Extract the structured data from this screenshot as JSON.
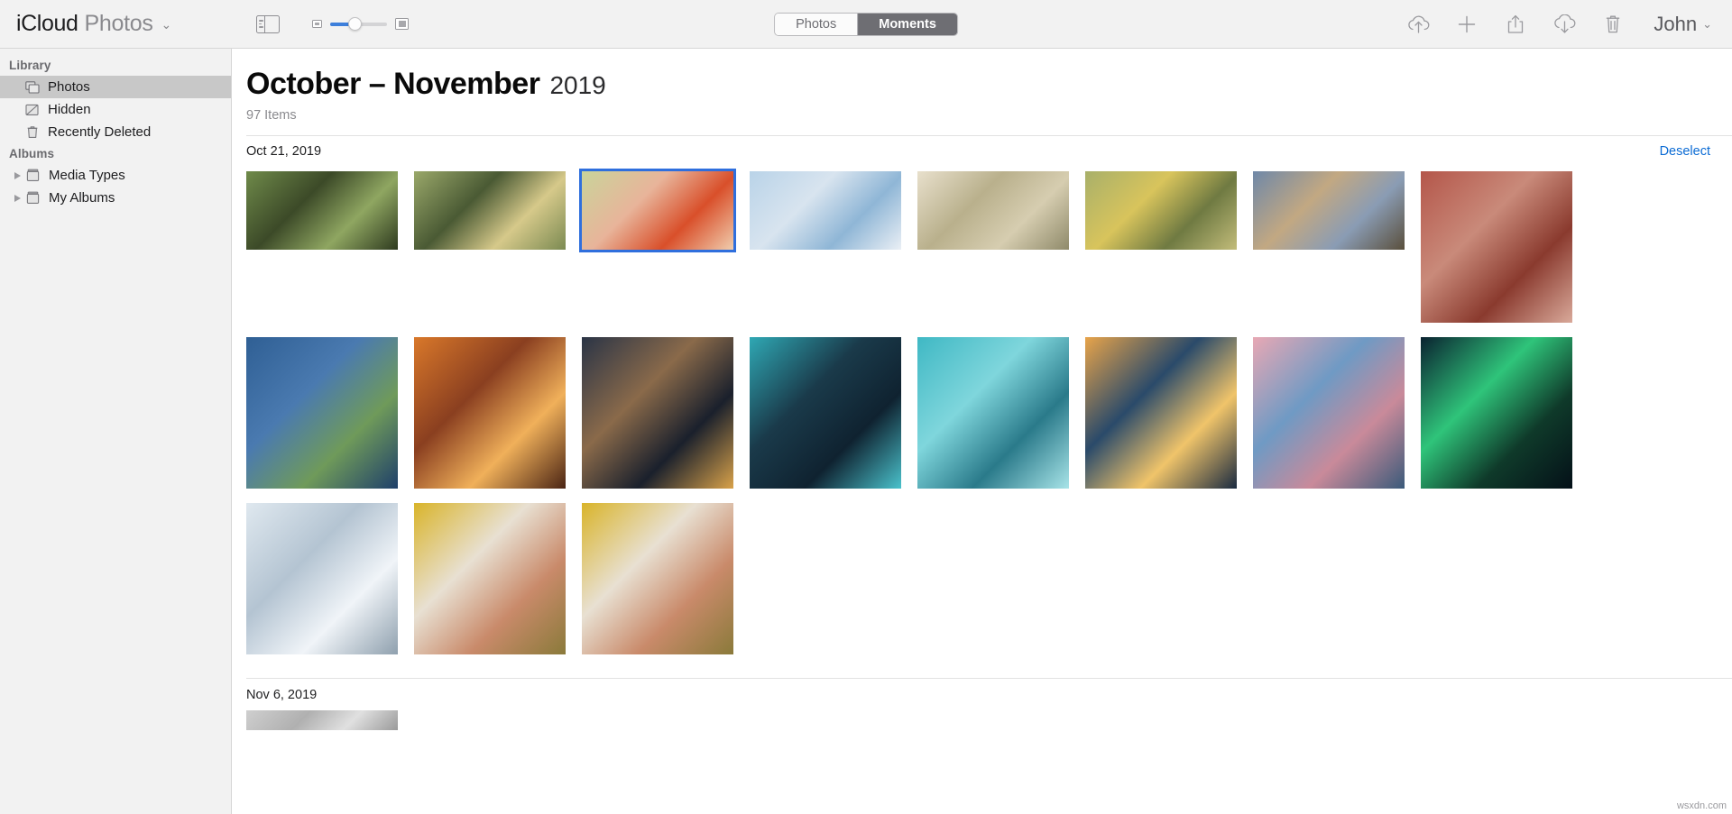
{
  "toolbar": {
    "brand_primary": "iCloud",
    "brand_secondary": "Photos",
    "brand_caret": "⌄",
    "sidebar_toggle_icon": "sidebar-toggle-icon",
    "zoom_small_icon": "small-thumbnail-icon",
    "zoom_large_icon": "large-thumbnail-icon",
    "zoom_value_percent": 38,
    "segments": [
      {
        "label": "Photos",
        "active": false
      },
      {
        "label": "Moments",
        "active": true
      }
    ],
    "actions": [
      {
        "name": "upload-icon",
        "title": "Upload"
      },
      {
        "name": "plus-icon",
        "title": "Add"
      },
      {
        "name": "share-icon",
        "title": "Share"
      },
      {
        "name": "download-icon",
        "title": "Download"
      },
      {
        "name": "trash-icon",
        "title": "Delete"
      }
    ],
    "account_name": "John",
    "account_caret": "⌄"
  },
  "sidebar": {
    "sections": [
      {
        "title": "Library",
        "items": [
          {
            "label": "Photos",
            "icon": "photos-stack-icon",
            "selected": true,
            "expandable": false
          },
          {
            "label": "Hidden",
            "icon": "hidden-icon",
            "selected": false,
            "expandable": false
          },
          {
            "label": "Recently Deleted",
            "icon": "trash-icon",
            "selected": false,
            "expandable": false
          }
        ]
      },
      {
        "title": "Albums",
        "items": [
          {
            "label": "Media Types",
            "icon": "album-folder-icon",
            "selected": false,
            "expandable": true
          },
          {
            "label": "My Albums",
            "icon": "album-folder-icon",
            "selected": false,
            "expandable": true
          }
        ]
      }
    ]
  },
  "main": {
    "title_range": "October – November",
    "title_year": "2019",
    "item_count": "97 Items",
    "groups": [
      {
        "date": "Oct 21, 2019",
        "action_label": "Deselect",
        "photos": [
          {
            "name": "photo-birdhouse-autumn",
            "selected": false,
            "tall": false,
            "colors": [
              "#6f8a4a",
              "#3c4a28",
              "#8fa661",
              "#2e3a1f"
            ]
          },
          {
            "name": "photo-tree-blossom",
            "selected": false,
            "tall": false,
            "colors": [
              "#9aa86a",
              "#4a5a34",
              "#d6c98a",
              "#7b8a52"
            ]
          },
          {
            "name": "photo-red-leaf-hand",
            "selected": true,
            "tall": false,
            "colors": [
              "#c9d49a",
              "#e8b49a",
              "#d94f2a",
              "#f0cdae"
            ]
          },
          {
            "name": "photo-sky-pastel",
            "selected": false,
            "tall": false,
            "colors": [
              "#b9d3e8",
              "#d8e4ef",
              "#8fb6d6",
              "#eaeff5"
            ]
          },
          {
            "name": "photo-white-rose",
            "selected": false,
            "tall": false,
            "colors": [
              "#e8e0cc",
              "#b9b08c",
              "#d6cdb0",
              "#8f8a6a"
            ]
          },
          {
            "name": "photo-yellow-rose",
            "selected": false,
            "tall": false,
            "colors": [
              "#a8b06a",
              "#d8c45c",
              "#6f7a42",
              "#c2bc7a"
            ]
          },
          {
            "name": "photo-desert-road",
            "selected": false,
            "tall": false,
            "colors": [
              "#6f88a8",
              "#c2a882",
              "#8a9cb4",
              "#5a4f3c"
            ]
          },
          {
            "name": "photo-pink-blossom-wall",
            "selected": false,
            "tall": true,
            "colors": [
              "#b4564a",
              "#c98a7a",
              "#8a3a2e",
              "#d9a99a"
            ]
          },
          {
            "name": "photo-tiny-planet-castle",
            "selected": false,
            "tall": true,
            "colors": [
              "#2f5f94",
              "#4a7ab0",
              "#6f9a5a",
              "#1e3f6a"
            ]
          },
          {
            "name": "photo-sunset-street",
            "selected": false,
            "tall": true,
            "colors": [
              "#d9782a",
              "#8a3f20",
              "#f0b05a",
              "#4a2414"
            ]
          },
          {
            "name": "photo-night-city-street",
            "selected": false,
            "tall": true,
            "colors": [
              "#2a3446",
              "#8a6a4a",
              "#1a202c",
              "#d9a24a"
            ]
          },
          {
            "name": "photo-city-skyline-dusk",
            "selected": false,
            "tall": true,
            "colors": [
              "#2fa8b4",
              "#1a3a4a",
              "#0f2230",
              "#4ac2cc"
            ]
          },
          {
            "name": "photo-heart-island",
            "selected": false,
            "tall": true,
            "colors": [
              "#3fb8c4",
              "#7fd6dc",
              "#2a7a8a",
              "#a8e4e8"
            ]
          },
          {
            "name": "photo-eiffel-tower-sunset",
            "selected": false,
            "tall": true,
            "colors": [
              "#e8a44a",
              "#2a4a6a",
              "#f0c46a",
              "#1a2a40"
            ]
          },
          {
            "name": "photo-pink-clouds-lake",
            "selected": false,
            "tall": true,
            "colors": [
              "#e8a8b4",
              "#6f9ac4",
              "#c98a9a",
              "#3a5a7a"
            ]
          },
          {
            "name": "photo-aurora-green",
            "selected": false,
            "tall": true,
            "colors": [
              "#0a2230",
              "#2fc47a",
              "#0f3a2a",
              "#041018"
            ]
          },
          {
            "name": "photo-winter-forest-snow",
            "selected": false,
            "tall": true,
            "colors": [
              "#dfe8ef",
              "#b4c4d2",
              "#f0f4f8",
              "#8fa0ae"
            ]
          },
          {
            "name": "photo-ginkgo-window-1",
            "selected": false,
            "tall": true,
            "colors": [
              "#d9b42a",
              "#e8e0d2",
              "#c98a6a",
              "#8a7a3a"
            ]
          },
          {
            "name": "photo-ginkgo-window-2",
            "selected": false,
            "tall": true,
            "colors": [
              "#d9b42a",
              "#e8e0d2",
              "#c98a6a",
              "#8a7a3a"
            ]
          }
        ]
      },
      {
        "date": "Nov 6, 2019",
        "action_label": "",
        "photos": [
          {
            "name": "photo-next-group-1",
            "selected": false,
            "tall": false,
            "colors": [
              "#cfcfcf",
              "#b0b0b0",
              "#e0e0e0",
              "#9a9a9a"
            ]
          }
        ]
      }
    ]
  },
  "watermark": "wsxdn.com",
  "colors": {
    "accent_link": "#0b6bd4",
    "selection_border": "#2f6fdd",
    "sidebar_selected": "#c8c8c8",
    "toolbar_bg": "#f2f2f2",
    "slider_fill": "#3d7fdb"
  }
}
